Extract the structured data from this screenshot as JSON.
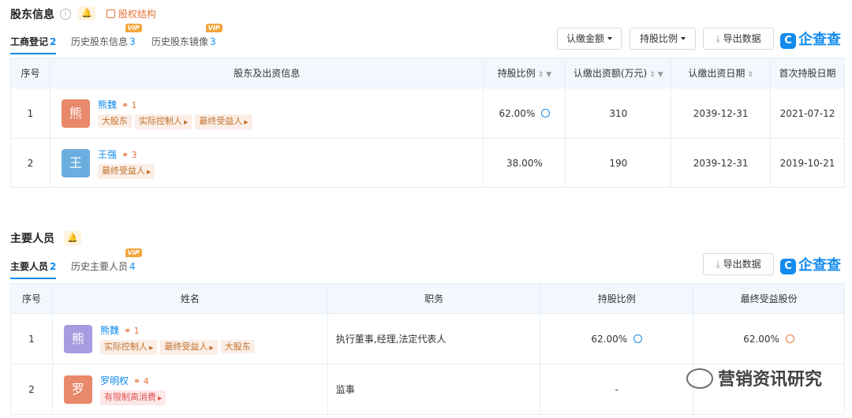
{
  "shareholders": {
    "title": "股东信息",
    "structure_link": "股权结构",
    "tabs": [
      {
        "label": "工商登记",
        "count": "2"
      },
      {
        "label": "历史股东信息",
        "count": "3",
        "vip": "VIP"
      },
      {
        "label": "历史股东镜像",
        "count": "3",
        "vip": "VIP"
      }
    ],
    "buttons": {
      "amount": "认缴金额",
      "ratio": "持股比例",
      "export": "导出数据"
    },
    "logo": "企查查",
    "columns": [
      "序号",
      "股东及出资信息",
      "持股比例",
      "认缴出资额(万元)",
      "认缴出资日期",
      "首次持股日期"
    ],
    "rows": [
      {
        "index": "1",
        "avatar": "熊",
        "avatar_color": "#e8896b",
        "name": "熊魏",
        "relations": "1",
        "tags": [
          "大股东",
          "实际控制人",
          "最终受益人"
        ],
        "ratio": "62.00%",
        "amount": "310",
        "subscribe_date": "2039-12-31",
        "first_date": "2021-07-12"
      },
      {
        "index": "2",
        "avatar": "王",
        "avatar_color": "#6aaee0",
        "name": "王强",
        "relations": "3",
        "tags": [
          "最终受益人"
        ],
        "ratio": "38.00%",
        "amount": "190",
        "subscribe_date": "2039-12-31",
        "first_date": "2019-10-21"
      }
    ]
  },
  "personnel": {
    "title": "主要人员",
    "tabs": [
      {
        "label": "主要人员",
        "count": "2"
      },
      {
        "label": "历史主要人员",
        "count": "4",
        "vip": "VIP"
      }
    ],
    "buttons": {
      "export": "导出数据"
    },
    "logo": "企查查",
    "columns": [
      "序号",
      "姓名",
      "职务",
      "持股比例",
      "最终受益股份"
    ],
    "rows": [
      {
        "index": "1",
        "avatar": "熊",
        "avatar_color": "#a89be0",
        "name": "熊魏",
        "relations": "1",
        "tags": [
          "实际控制人",
          "最终受益人",
          "大股东"
        ],
        "position": "执行董事,经理,法定代表人",
        "ratio": "62.00%",
        "benefit": "62.00%"
      },
      {
        "index": "2",
        "avatar": "罗",
        "avatar_color": "#e8896b",
        "name": "罗明权",
        "relations": "4",
        "tags": [
          "有限制高消费"
        ],
        "position": "监事",
        "ratio": "-",
        "benefit": ""
      }
    ]
  },
  "watermark": "营销资讯研究"
}
